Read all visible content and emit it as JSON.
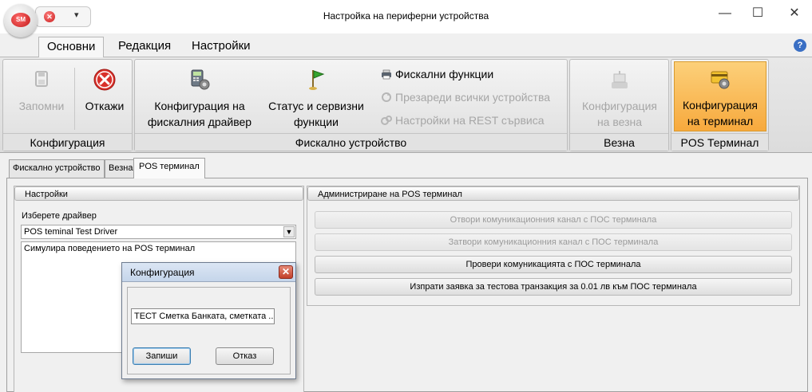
{
  "window": {
    "title": "Настройка на периферни устройства",
    "app_badge": "SM",
    "min_glyph": "—",
    "max_glyph": "☐",
    "close_glyph": "✕",
    "qat_close_glyph": "✕",
    "qat_dropdown_glyph": "▾"
  },
  "ribbon_tabs": [
    "Основни",
    "Редакция",
    "Настройки"
  ],
  "help_glyph": "?",
  "ribbon": {
    "groups": [
      {
        "label": "Конфигурация"
      },
      {
        "label": "Фискално устройство"
      },
      {
        "label": "Везна"
      },
      {
        "label": "POS Терминал"
      }
    ],
    "buttons": {
      "save": {
        "label": "Запомни",
        "icon": "save-icon",
        "enabled": false
      },
      "cancel": {
        "label": "Откажи",
        "icon": "cancel-x-icon",
        "enabled": true
      },
      "fiscal_driver_config": {
        "line1": "Конфигурация на",
        "line2": "фискалния драйвер",
        "icon": "fiscal-printer-icon"
      },
      "status_service": {
        "line1": "Статус и сервизни",
        "line2": "функции",
        "icon": "flag-icon"
      },
      "fiscal_functions": {
        "label": "Фискални функции",
        "icon": "printer-small-icon",
        "enabled": true
      },
      "reload_devices": {
        "label": "Презареди всички устройства",
        "icon": "reload-icon",
        "enabled": false
      },
      "rest_settings": {
        "label": "Настройки на REST сървиса",
        "icon": "settings-icon",
        "enabled": false
      },
      "scale_config": {
        "line1": "Конфигурация",
        "line2": "на везна",
        "icon": "scale-icon",
        "enabled": false
      },
      "terminal_config": {
        "line1": "Конфигурация",
        "line2": "на терминал",
        "icon": "terminal-card-icon",
        "active": true
      }
    }
  },
  "doc_tabs": [
    "Фискално устройство",
    "Везна",
    "POS терминал"
  ],
  "settings_panel": {
    "header": "Настройки",
    "driver_label": "Изберете драйвер",
    "driver_value": "POS teminal Test Driver",
    "description": "Симулира поведението на POS терминал"
  },
  "admin_panel": {
    "header": "Администриране на POS терминал",
    "actions": [
      {
        "label": "Отвори комуникационния канал с ПОС терминала",
        "enabled": false
      },
      {
        "label": "Затвори комуникационния канал с ПОС терминала",
        "enabled": false
      },
      {
        "label": "Провери комуникацията с ПОС терминала",
        "enabled": true
      },
      {
        "label": "Изпрати заявка за тестова транзакция за 0.01 лв към ПОС терминала",
        "enabled": true
      }
    ]
  },
  "dialog": {
    "title": "Конфигурация",
    "close_glyph": "✕",
    "input_value": "ТЕСТ Сметка Банката, сметката ..",
    "save_label": "Запиши",
    "cancel_label": "Отказ"
  },
  "colors": {
    "active_button": "#f7a93d",
    "dialog_title": "#c5d5ea",
    "dialog_close": "#c2402a"
  }
}
